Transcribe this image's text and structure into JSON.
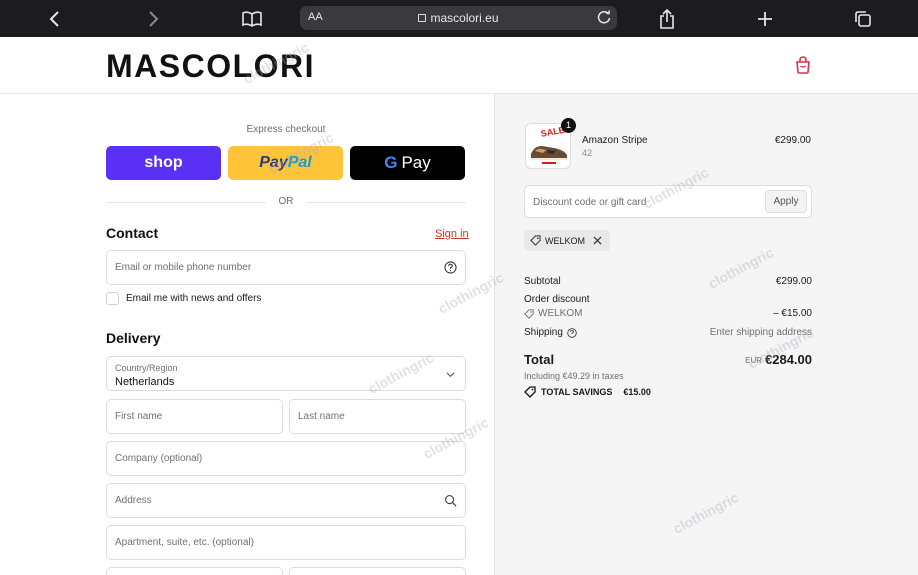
{
  "browser": {
    "text_size": "AA",
    "url": "mascolori.eu"
  },
  "header": {
    "logo": "MASCOLORI"
  },
  "express": {
    "label": "Express checkout",
    "shop_label": "shop",
    "paypal_part1": "Pay",
    "paypal_part2": "Pal",
    "gpay_label": "Pay",
    "gpay_g": "G",
    "or_label": "OR"
  },
  "contact": {
    "title": "Contact",
    "signin": "Sign in",
    "email_placeholder": "Email or mobile phone number",
    "newsletter_label": "Email me with news and offers",
    "newsletter_checked": false
  },
  "delivery": {
    "title": "Delivery",
    "country_label": "Country/Region",
    "country_value": "Netherlands",
    "first_name_placeholder": "First name",
    "last_name_placeholder": "Last name",
    "company_placeholder": "Company (optional)",
    "address_placeholder": "Address",
    "apartment_placeholder": "Apartment, suite, etc. (optional)"
  },
  "cart": {
    "item": {
      "name": "Amazon Stripe",
      "variant": "42",
      "price": "€299.00",
      "quantity": "1",
      "thumb_text": "SALE!"
    },
    "discount_placeholder": "Discount code or gift card",
    "apply_label": "Apply",
    "applied_code": "WELKOM"
  },
  "summary": {
    "subtotal_label": "Subtotal",
    "subtotal_value": "€299.00",
    "order_discount_label": "Order discount",
    "discount_code": "WELKOM",
    "discount_value": "– €15.00",
    "shipping_label": "Shipping",
    "shipping_value": "Enter shipping address",
    "total_label": "Total",
    "currency": "EUR",
    "total_value": "€284.00",
    "tax_line": "Including €49.29 in taxes",
    "savings_label": "TOTAL SAVINGS",
    "savings_value": "€15.00"
  },
  "watermark": "clothingric",
  "colors": {
    "shop_purple": "#5a31f4",
    "paypal_yellow": "#ffc439",
    "signin_red": "#c0392b",
    "bag_red": "#d8334a"
  }
}
